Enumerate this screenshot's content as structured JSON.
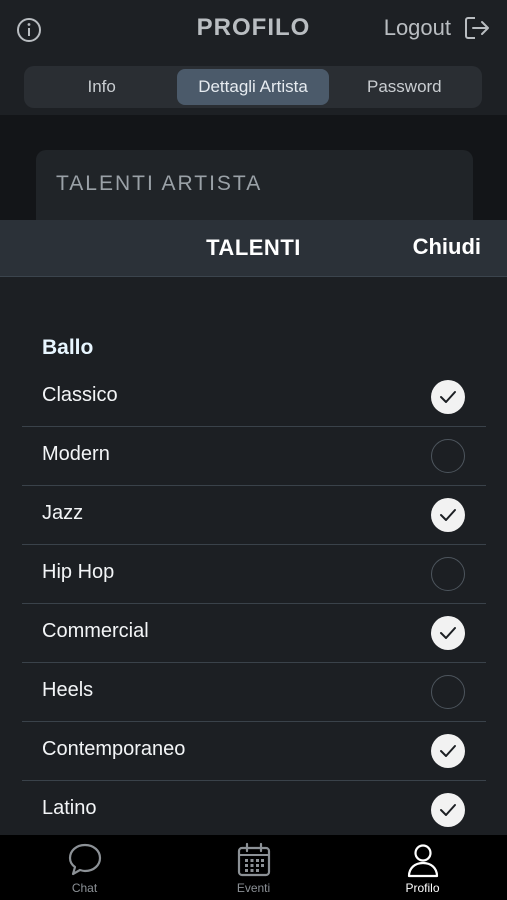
{
  "header": {
    "title": "PROFILO",
    "logout_label": "Logout",
    "tabs": [
      {
        "label": "Info",
        "active": false
      },
      {
        "label": "Dettagli Artista",
        "active": true
      },
      {
        "label": "Password",
        "active": false
      }
    ]
  },
  "background_card": {
    "title": "TALENTI ARTISTA"
  },
  "sheet": {
    "title": "TALENTI",
    "close_label": "Chiudi",
    "section": "Ballo",
    "items": [
      {
        "label": "Classico",
        "checked": true
      },
      {
        "label": "Modern",
        "checked": false
      },
      {
        "label": "Jazz",
        "checked": true
      },
      {
        "label": "Hip Hop",
        "checked": false
      },
      {
        "label": "Commercial",
        "checked": true
      },
      {
        "label": "Heels",
        "checked": false
      },
      {
        "label": "Contemporaneo",
        "checked": true
      },
      {
        "label": "Latino",
        "checked": true
      }
    ]
  },
  "tabbar": {
    "items": [
      {
        "label": "Chat",
        "icon": "chat-bubble-icon",
        "active": false
      },
      {
        "label": "Eventi",
        "icon": "calendar-icon",
        "active": false
      },
      {
        "label": "Profilo",
        "icon": "person-icon",
        "active": true
      }
    ]
  },
  "colors": {
    "background": "#131518",
    "sheet": "#1c1f23",
    "sheet_header": "#2b3138",
    "active_segment": "#4b5a6a",
    "check_on": "#f2f2f2"
  }
}
